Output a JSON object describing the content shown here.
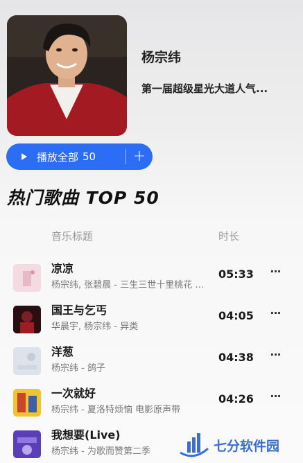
{
  "artist": {
    "name": "杨宗纬",
    "description": "第一届超级星光大道人气..."
  },
  "play_all": {
    "label": "播放全部",
    "count": "50",
    "add_symbol": "+"
  },
  "section": {
    "title": "热门歌曲 TOP 50"
  },
  "columns": {
    "title": "音乐标题",
    "duration": "时长"
  },
  "tracks": [
    {
      "name": "凉凉",
      "subtitle": "杨宗纬, 张碧晨 - 三生三世十里桃花 电视剧原声带",
      "duration": "05:33",
      "more": "···"
    },
    {
      "name": "国王与乞丐",
      "subtitle": "华晨宇, 杨宗纬 - 异类",
      "duration": "04:05",
      "more": "···"
    },
    {
      "name": "洋葱",
      "subtitle": "杨宗纬 - 鸽子",
      "duration": "04:38",
      "more": "···"
    },
    {
      "name": "一次就好",
      "subtitle": "杨宗纬 - 夏洛特烦恼 电影原声带",
      "duration": "04:26",
      "more": "···"
    },
    {
      "name": "我想要(Live)",
      "subtitle": "杨宗纬 - 为歌而赞第二季",
      "duration": "",
      "more": ""
    }
  ],
  "watermark": {
    "text": "七分软件园"
  },
  "colors": {
    "accent": "#2b6df5",
    "watermark": "#3b6fc9"
  }
}
